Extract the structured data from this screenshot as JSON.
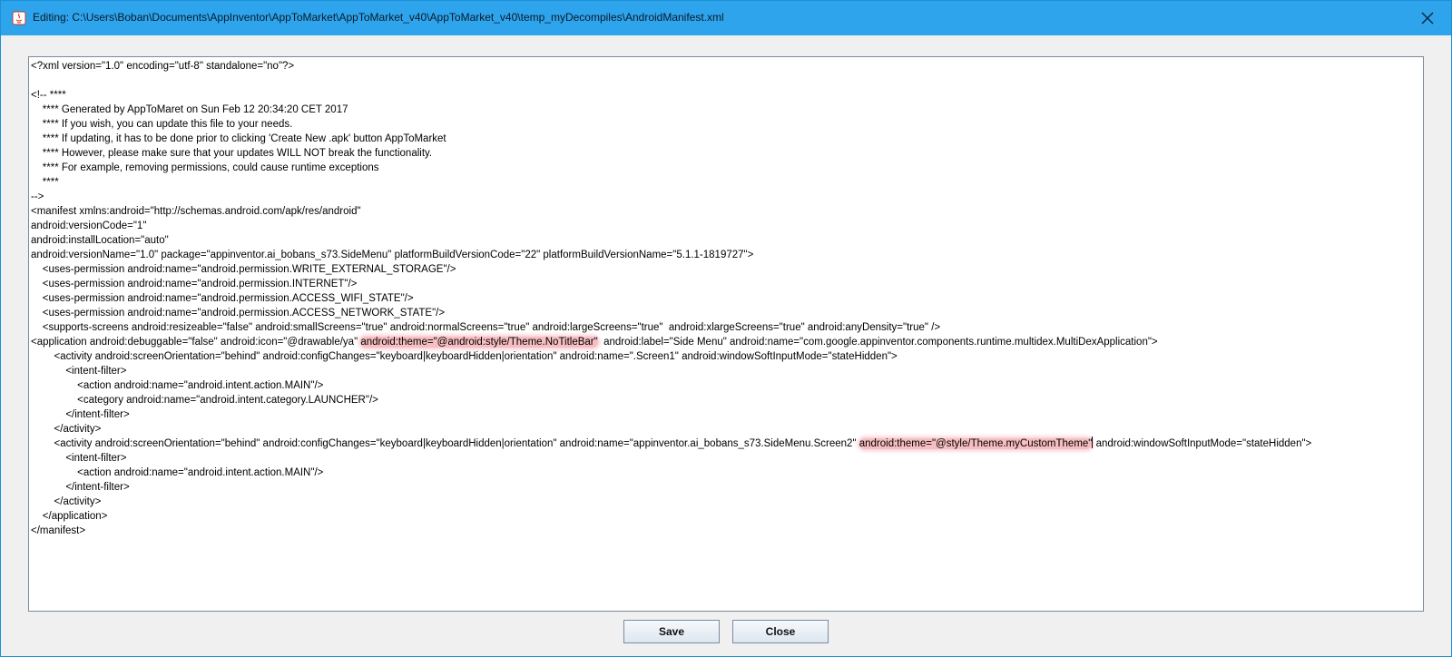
{
  "window": {
    "title": "Editing: C:\\Users\\Boban\\Documents\\AppInventor\\AppToMarket\\AppToMarket_v40\\AppToMarket_v40\\temp_myDecompiles\\AndroidManifest.xml",
    "accent_color": "#2ea4ec",
    "close_icon": "close-icon"
  },
  "editor": {
    "lines": [
      "<?xml version=\"1.0\" encoding=\"utf-8\" standalone=\"no\"?>",
      "",
      "<!-- ****",
      "    **** Generated by AppToMaret on Sun Feb 12 20:34:20 CET 2017",
      "    **** If you wish, you can update this file to your needs.",
      "    **** If updating, it has to be done prior to clicking 'Create New .apk' button AppToMarket",
      "    **** However, please make sure that your updates WILL NOT break the functionality.",
      "    **** For example, removing permissions, could cause runtime exceptions",
      "    ****",
      "-->",
      "<manifest xmlns:android=\"http://schemas.android.com/apk/res/android\"",
      "android:versionCode=\"1\"",
      "android:installLocation=\"auto\"",
      "android:versionName=\"1.0\" package=\"appinventor.ai_bobans_s73.SideMenu\" platformBuildVersionCode=\"22\" platformBuildVersionName=\"5.1.1-1819727\">",
      "    <uses-permission android:name=\"android.permission.WRITE_EXTERNAL_STORAGE\"/>",
      "    <uses-permission android:name=\"android.permission.INTERNET\"/>",
      "    <uses-permission android:name=\"android.permission.ACCESS_WIFI_STATE\"/>",
      "    <uses-permission android:name=\"android.permission.ACCESS_NETWORK_STATE\"/>",
      "    <supports-screens android:resizeable=\"false\" android:smallScreens=\"true\" android:normalScreens=\"true\" android:largeScreens=\"true\"  android:xlargeScreens=\"true\" android:anyDensity=\"true\" />",
      "",
      "        <activity android:screenOrientation=\"behind\" android:configChanges=\"keyboard|keyboardHidden|orientation\" android:name=\".Screen1\" android:windowSoftInputMode=\"stateHidden\">",
      "            <intent-filter>",
      "                <action android:name=\"android.intent.action.MAIN\"/>",
      "                <category android:name=\"android.intent.category.LAUNCHER\"/>",
      "            </intent-filter>",
      "        </activity>",
      "",
      "            <intent-filter>",
      "                <action android:name=\"android.intent.action.MAIN\"/>",
      "            </intent-filter>",
      "        </activity>",
      "    </application>",
      "</manifest>"
    ],
    "line19": {
      "pre": "<application android:debuggable=\"false\" android:icon=\"@drawable/ya\" ",
      "mark": "android:theme=\"@android:style/Theme.NoTitleBar\"",
      "post": "  android:label=\"Side Menu\" android:name=\"com.google.appinventor.components.runtime.multidex.MultiDexApplication\">"
    },
    "line26": {
      "pre": "        <activity android:screenOrientation=\"behind\" android:configChanges=\"keyboard|keyboardHidden|orientation\" android:name=\"appinventor.ai_bobans_s73.SideMenu.Screen2\" ",
      "mark": "android:theme=\"@style/Theme.myCustomTheme\"",
      "post": " android:windowSoftInputMode=\"stateHidden\">"
    }
  },
  "buttons": {
    "save_label": "Save",
    "close_label": "Close"
  }
}
